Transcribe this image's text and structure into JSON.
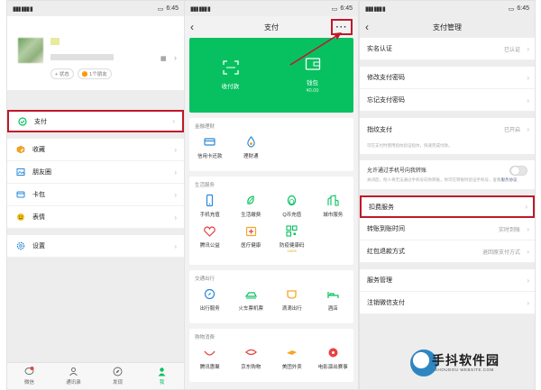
{
  "status_bar": {
    "time": "6:45",
    "battery": "29"
  },
  "panel_me": {
    "profile": {
      "tag_status": "+ 状态",
      "tag_friends": "1个朋友"
    },
    "menu": [
      {
        "label": "支付",
        "icon": "pay-icon"
      },
      {
        "label": "收藏",
        "icon": "favorites-icon"
      },
      {
        "label": "朋友圈",
        "icon": "moments-icon"
      },
      {
        "label": "卡包",
        "icon": "cards-icon"
      },
      {
        "label": "表情",
        "icon": "sticker-icon"
      },
      {
        "label": "设置",
        "icon": "settings-icon"
      }
    ],
    "tabs": [
      {
        "label": "微信",
        "badge": "3"
      },
      {
        "label": "通讯录"
      },
      {
        "label": "发现"
      },
      {
        "label": "我"
      }
    ]
  },
  "panel_pay": {
    "title": "支付",
    "more": "···",
    "green": [
      {
        "label": "收付款"
      },
      {
        "label": "钱包",
        "sub": "¥0.00"
      }
    ],
    "sections": [
      {
        "head": "金融理财",
        "items": [
          {
            "label": "信用卡还款"
          },
          {
            "label": "理财通"
          }
        ]
      },
      {
        "head": "生活服务",
        "items": [
          {
            "label": "手机充值"
          },
          {
            "label": "生活缴费"
          },
          {
            "label": "Q币充值"
          },
          {
            "label": "城市服务"
          },
          {
            "label": "腾讯公益"
          },
          {
            "label": "医疗健康"
          },
          {
            "label": "防疫健康码",
            "mini": "100%"
          }
        ]
      },
      {
        "head": "交通出行",
        "items": [
          {
            "label": "出行服务"
          },
          {
            "label": "火车票机票"
          },
          {
            "label": "滴滴出行"
          },
          {
            "label": "酒店"
          }
        ]
      },
      {
        "head": "购物消费",
        "items": [
          {
            "label": "腾讯惠聚"
          },
          {
            "label": "京东购物"
          },
          {
            "label": "美团外卖"
          },
          {
            "label": "电影演出赛事"
          }
        ]
      }
    ]
  },
  "panel_manage": {
    "title": "支付管理",
    "group1": [
      {
        "label": "实名认证",
        "value": "已认证"
      }
    ],
    "group2": [
      {
        "label": "修改支付密码"
      },
      {
        "label": "忘记支付密码"
      }
    ],
    "group3": [
      {
        "label": "指纹支付",
        "value": "已开启"
      }
    ],
    "group3_note": "可在支付时使用指纹验证指纹，快速完成付款。",
    "toggle": {
      "label": "允许通过手机号向我转账",
      "desc": "关闭后，他人将无法通过手机号向你转账，你可在转账时验证手机号，查看",
      "link": "服务协议"
    },
    "group4": [
      {
        "label": "扣费服务"
      },
      {
        "label": "转账到账时间",
        "value": "实时到账"
      },
      {
        "label": "红包退款方式",
        "value": "退回原支付方式"
      }
    ],
    "group5": [
      {
        "label": "服务管理"
      },
      {
        "label": "注销微信支付"
      }
    ]
  },
  "watermark": {
    "text": "手抖软件园",
    "sub": "SHOUDOU WEBSITE.COM"
  },
  "colors": {
    "wechat_green": "#07c160",
    "highlight_red": "#c0182a"
  }
}
